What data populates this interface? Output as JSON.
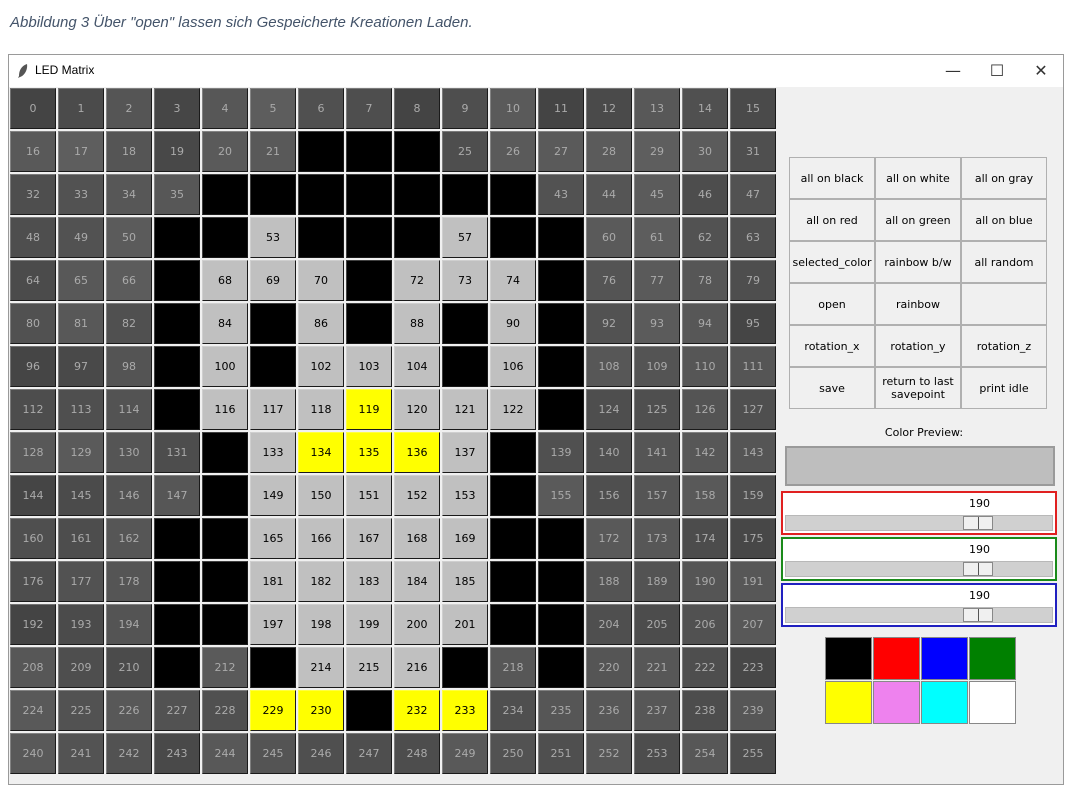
{
  "caption": "Abbildung 3 Über \"open\" lassen sich Gespeicherte Kreationen Laden.",
  "window": {
    "title": "LED Matrix",
    "controls": {
      "minimize": "—",
      "maximize": "☐",
      "close": "✕"
    }
  },
  "matrix": {
    "columns": 16,
    "cell_colors": [
      "#444444",
      "#4b4b4b",
      "#555555",
      "#464646",
      "#575757",
      "#5d5d5d",
      "#505050",
      "#4e4e4e",
      "#444444",
      "#4e4e4e",
      "#5a5a5a",
      "#444444",
      "#4a4a4a",
      "#585858",
      "#505050",
      "#4a4a4a",
      "#595959",
      "#5e5e5e",
      "#555555",
      "#484848",
      "#5a5a5a",
      "#595959",
      "#000000",
      "#000000",
      "#000000",
      "#4e4e4e",
      "#5a5a5a",
      "#5a5a5a",
      "#5b5b5b",
      "#5e5e5e",
      "#5b5b5b",
      "#4f4f4f",
      "#4e4e4e",
      "#525252",
      "#575757",
      "#575757",
      "#000000",
      "#000000",
      "#000000",
      "#000000",
      "#000000",
      "#000000",
      "#000000",
      "#525252",
      "#555555",
      "#5b5b5b",
      "#4d4d4d",
      "#525252",
      "#4e4e4e",
      "#525252",
      "#5b5b5b",
      "#000000",
      "#000000",
      "#c0c0c0",
      "#000000",
      "#000000",
      "#000000",
      "#c0c0c0",
      "#000000",
      "#000000",
      "#5a5a5a",
      "#5d5d5d",
      "#525252",
      "#505050",
      "#4b4b4b",
      "#585858",
      "#5c5c5c",
      "#000000",
      "#c0c0c0",
      "#c0c0c0",
      "#c0c0c0",
      "#000000",
      "#c0c0c0",
      "#c0c0c0",
      "#c0c0c0",
      "#000000",
      "#545454",
      "#5a5a5a",
      "#565656",
      "#4e4e4e",
      "#515151",
      "#585858",
      "#505050",
      "#000000",
      "#c0c0c0",
      "#000000",
      "#c0c0c0",
      "#000000",
      "#c0c0c0",
      "#000000",
      "#c0c0c0",
      "#000000",
      "#525252",
      "#5b5b5b",
      "#575757",
      "#454545",
      "#454545",
      "#494949",
      "#545454",
      "#000000",
      "#c0c0c0",
      "#000000",
      "#c0c0c0",
      "#c0c0c0",
      "#c0c0c0",
      "#000000",
      "#c0c0c0",
      "#000000",
      "#575757",
      "#545454",
      "#565656",
      "#555555",
      "#4d4d4d",
      "#4f4f4f",
      "#535353",
      "#000000",
      "#c0c0c0",
      "#c0c0c0",
      "#c0c0c0",
      "#ffff00",
      "#c0c0c0",
      "#c0c0c0",
      "#c0c0c0",
      "#000000",
      "#4e4e4e",
      "#4f4f4f",
      "#545454",
      "#4f4f4f",
      "#585858",
      "#5a5a5a",
      "#555555",
      "#4d4d4d",
      "#000000",
      "#c0c0c0",
      "#ffff00",
      "#ffff00",
      "#ffff00",
      "#c0c0c0",
      "#000000",
      "#505050",
      "#505050",
      "#555555",
      "#575757",
      "#555555",
      "#454545",
      "#4b4b4b",
      "#535353",
      "#565656",
      "#000000",
      "#c0c0c0",
      "#c0c0c0",
      "#c0c0c0",
      "#c0c0c0",
      "#c0c0c0",
      "#000000",
      "#5a5a5a",
      "#4f4f4f",
      "#555555",
      "#595959",
      "#4e4e4e",
      "#4f4f4f",
      "#4d4d4d",
      "#565656",
      "#000000",
      "#000000",
      "#c0c0c0",
      "#c0c0c0",
      "#c0c0c0",
      "#c0c0c0",
      "#c0c0c0",
      "#000000",
      "#000000",
      "#595959",
      "#575757",
      "#4c4c4c",
      "#474747",
      "#4d4d4d",
      "#525252",
      "#555555",
      "#000000",
      "#000000",
      "#c0c0c0",
      "#c0c0c0",
      "#c0c0c0",
      "#c0c0c0",
      "#c0c0c0",
      "#000000",
      "#000000",
      "#545454",
      "#535353",
      "#555555",
      "#575757",
      "#444444",
      "#4b4b4b",
      "#545454",
      "#000000",
      "#000000",
      "#c0c0c0",
      "#c0c0c0",
      "#c0c0c0",
      "#c0c0c0",
      "#c0c0c0",
      "#000000",
      "#000000",
      "#4f4f4f",
      "#4c4c4c",
      "#515151",
      "#585858",
      "#575757",
      "#4e4e4e",
      "#4b4b4b",
      "#000000",
      "#5a5a5a",
      "#000000",
      "#c0c0c0",
      "#c0c0c0",
      "#c0c0c0",
      "#000000",
      "#575757",
      "#000000",
      "#555555",
      "#575757",
      "#4e4e4e",
      "#474747",
      "#595959",
      "#525252",
      "#585858",
      "#525252",
      "#505050",
      "#ffff00",
      "#ffff00",
      "#000000",
      "#ffff00",
      "#ffff00",
      "#4f4f4f",
      "#565656",
      "#575757",
      "#575757",
      "#4d4d4d",
      "#565656",
      "#595959",
      "#535353",
      "#525252",
      "#494949",
      "#585858",
      "#545454",
      "#4f4f4f",
      "#4e4e4e",
      "#4d4d4d",
      "#595959",
      "#525252",
      "#4f4f4f",
      "#575757",
      "#4d4d4d",
      "#575757",
      "#4d4d4d"
    ]
  },
  "buttons": {
    "all_on_black": "all on black",
    "all_on_white": "all on white",
    "all_on_gray": "all on gray",
    "all_on_red": "all on red",
    "all_on_green": "all on green",
    "all_on_blue": "all on blue",
    "selected_color": "selected_color",
    "rainbow_bw": "rainbow b/w",
    "all_random": "all random",
    "open": "open",
    "rainbow": "rainbow",
    "blank": "",
    "rotation_x": "rotation_x",
    "rotation_y": "rotation_y",
    "rotation_z": "rotation_z",
    "save": "save",
    "return_to_last_savepoint": "return to last savepoint",
    "print_idle": "print idle"
  },
  "color_preview": {
    "label": "Color Preview:",
    "color": "#bebebe"
  },
  "sliders": [
    {
      "channel": "red",
      "value": "190",
      "fraction": 0.745,
      "border": "#e02020"
    },
    {
      "channel": "green",
      "value": "190",
      "fraction": 0.745,
      "border": "#1a8a1a"
    },
    {
      "channel": "blue",
      "value": "190",
      "fraction": 0.745,
      "border": "#2020c0"
    }
  ],
  "palette": [
    {
      "name": "black",
      "color": "#000000"
    },
    {
      "name": "red",
      "color": "#ff0000"
    },
    {
      "name": "blue",
      "color": "#0000ff"
    },
    {
      "name": "green",
      "color": "#008000"
    },
    {
      "name": "yellow",
      "color": "#ffff00"
    },
    {
      "name": "violet",
      "color": "#ee82ee"
    },
    {
      "name": "cyan",
      "color": "#00ffff"
    },
    {
      "name": "white",
      "color": "#ffffff"
    }
  ]
}
